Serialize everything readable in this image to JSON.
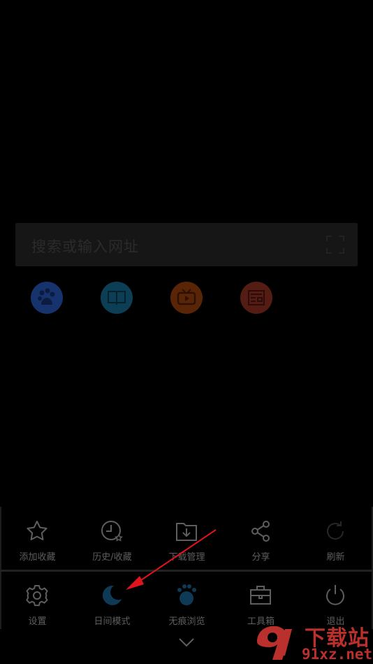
{
  "search": {
    "placeholder": "搜索或输入网址"
  },
  "quick_links": [
    {
      "icon": "baidu-paw-icon",
      "color": "#16336e"
    },
    {
      "icon": "book-icon",
      "color": "#0c3f55"
    },
    {
      "icon": "tv-icon",
      "color": "#5a2506"
    },
    {
      "icon": "news-icon",
      "color": "#551c14"
    }
  ],
  "menu": {
    "row1": [
      {
        "label": "添加收藏",
        "icon": "star-icon"
      },
      {
        "label": "历史/收藏",
        "icon": "clock-icon"
      },
      {
        "label": "下载管理",
        "icon": "download-folder-icon"
      },
      {
        "label": "分享",
        "icon": "share-icon"
      },
      {
        "label": "刷新",
        "icon": "refresh-icon"
      }
    ],
    "row2": [
      {
        "label": "设置",
        "icon": "gear-icon"
      },
      {
        "label": "日间模式",
        "icon": "moon-icon"
      },
      {
        "label": "无痕浏览",
        "icon": "paw-icon"
      },
      {
        "label": "工具箱",
        "icon": "toolbox-icon"
      },
      {
        "label": "退出",
        "icon": "power-icon"
      }
    ]
  },
  "watermark": {
    "text_cn": "下载站",
    "text_en": "91xz.net"
  },
  "colors": {
    "accent_moon": "#0e3a55",
    "arrow": "#e0141e",
    "watermark": "#b9302c"
  }
}
